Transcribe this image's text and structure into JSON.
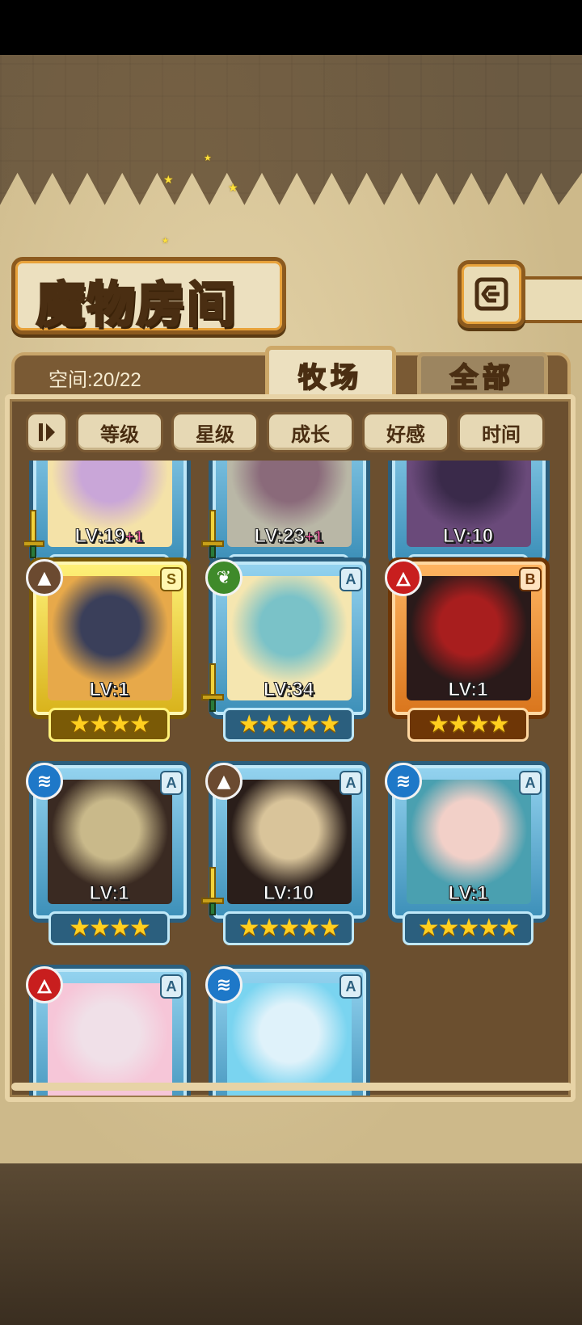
{
  "header": {
    "title": "魔物房间",
    "back_icon": "back-arrow-icon"
  },
  "capacity": {
    "label": "空间:20/22",
    "used": 20,
    "total": 22
  },
  "tabs": [
    {
      "label": "牧场",
      "active": true
    },
    {
      "label": "全部",
      "active": false
    }
  ],
  "filters": {
    "sort_icon": "sort-order-icon",
    "options": [
      "等级",
      "星级",
      "成长",
      "好感",
      "时间"
    ]
  },
  "colors": {
    "frame_blue": "#3c8fb8",
    "frame_gold": "#d8b21a",
    "frame_orange": "#d9751c",
    "fire": "#c81e1e",
    "water": "#1e78c8",
    "nature": "#3f8a2a",
    "earth": "#6b4a30"
  },
  "monsters": [
    {
      "level": "LV:19",
      "bonus": "+1",
      "stars": "★★★★",
      "frame": "blue",
      "element": null,
      "rank": null,
      "equipped": true,
      "portrait": [
        "#f4e2a8",
        "#c9a6d8"
      ]
    },
    {
      "level": "LV:23",
      "bonus": "+1",
      "stars": "★★★★",
      "frame": "blue",
      "element": null,
      "rank": null,
      "equipped": true,
      "portrait": [
        "#b9b7a6",
        "#8a6a7a"
      ]
    },
    {
      "level": "LV:10",
      "bonus": "",
      "stars": "★★★★",
      "frame": "blue",
      "element": null,
      "rank": null,
      "equipped": false,
      "portrait": [
        "#6a4a7a",
        "#3a2a4a"
      ]
    },
    {
      "level": "LV:1",
      "bonus": "",
      "stars": "★★★★",
      "frame": "gold",
      "element": "earth",
      "rank": "S",
      "equipped": false,
      "portrait": [
        "#e7a94a",
        "#3a3f5a"
      ]
    },
    {
      "level": "LV:34",
      "bonus": "",
      "stars": "★★★★★",
      "frame": "blue",
      "element": "nature",
      "rank": "A",
      "equipped": true,
      "portrait": [
        "#f5e6b0",
        "#7ac2c8"
      ]
    },
    {
      "level": "LV:1",
      "bonus": "",
      "stars": "★★★★",
      "frame": "orange",
      "element": "fire",
      "rank": "B",
      "equipped": false,
      "portrait": [
        "#2a1a1a",
        "#a81e1e"
      ]
    },
    {
      "level": "LV:1",
      "bonus": "",
      "stars": "★★★★",
      "frame": "blue",
      "element": "water",
      "rank": "A",
      "equipped": false,
      "portrait": [
        "#3a2a22",
        "#c9b98a"
      ]
    },
    {
      "level": "LV:10",
      "bonus": "",
      "stars": "★★★★★",
      "frame": "blue",
      "element": "earth",
      "rank": "A",
      "equipped": true,
      "portrait": [
        "#2a1e1a",
        "#d9c49a"
      ]
    },
    {
      "level": "LV:1",
      "bonus": "",
      "stars": "★★★★★",
      "frame": "blue",
      "element": "water",
      "rank": "A",
      "equipped": false,
      "portrait": [
        "#4aa0b0",
        "#f2d0c8"
      ]
    },
    {
      "level": "",
      "bonus": "",
      "stars": "",
      "frame": "blue",
      "element": "fire",
      "rank": "A",
      "equipped": false,
      "portrait": [
        "#f6c6d8",
        "#f0e0e8"
      ]
    },
    {
      "level": "",
      "bonus": "",
      "stars": "",
      "frame": "blue",
      "element": "water",
      "rank": "A",
      "equipped": false,
      "portrait": [
        "#7ad4f0",
        "#dff2fa"
      ]
    }
  ]
}
